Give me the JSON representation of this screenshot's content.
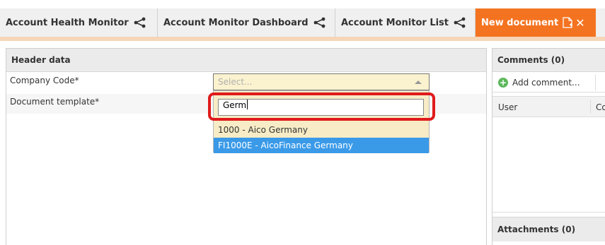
{
  "tabs": [
    {
      "label": "Account Health Monitor",
      "icon": "share-icon"
    },
    {
      "label": "Account Monitor Dashboard",
      "icon": "share-icon"
    },
    {
      "label": "Account Monitor List",
      "icon": "share-icon"
    }
  ],
  "active_tab": {
    "label": "New document",
    "icon": "new-document-icon",
    "close_glyph": "✕"
  },
  "header_panel": {
    "title": "Header data",
    "fields": [
      {
        "label": "Company Code*"
      },
      {
        "label": "Document template*"
      }
    ]
  },
  "company_code_select": {
    "placeholder": "Select...",
    "search_value": "Germ",
    "options": [
      {
        "label": "1000 - Aico Germany",
        "selected": false
      },
      {
        "label": "FI1000E - AicoFinance Germany",
        "selected": true
      }
    ]
  },
  "comments_panel": {
    "title": "Comments (0)",
    "add_label": "Add comment...",
    "columns": [
      "User",
      "Co"
    ]
  },
  "attachments_panel": {
    "title": "Attachments (0)"
  },
  "colors": {
    "accent": "#f47321",
    "highlight": "#e01b1b",
    "selected_option": "#3a9ae8",
    "dropdown_bg": "#f7ecc6",
    "add_icon": "#5cb85c"
  }
}
